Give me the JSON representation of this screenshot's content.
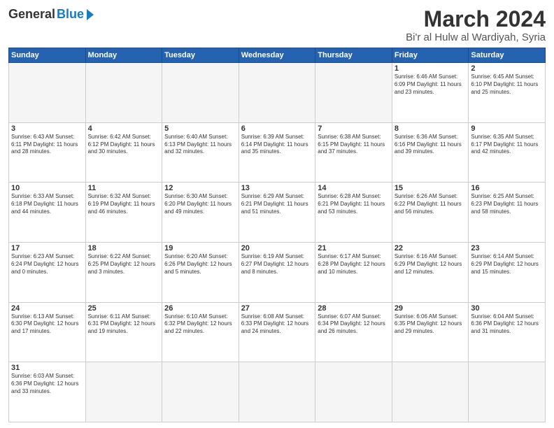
{
  "header": {
    "logo": {
      "general": "General",
      "blue": "Blue"
    },
    "title": "March 2024",
    "location": "Bi'r al Hulw al Wardiyah, Syria"
  },
  "weekdays": [
    "Sunday",
    "Monday",
    "Tuesday",
    "Wednesday",
    "Thursday",
    "Friday",
    "Saturday"
  ],
  "weeks": [
    [
      {
        "day": "",
        "info": ""
      },
      {
        "day": "",
        "info": ""
      },
      {
        "day": "",
        "info": ""
      },
      {
        "day": "",
        "info": ""
      },
      {
        "day": "",
        "info": ""
      },
      {
        "day": "1",
        "info": "Sunrise: 6:46 AM\nSunset: 6:09 PM\nDaylight: 11 hours\nand 23 minutes."
      },
      {
        "day": "2",
        "info": "Sunrise: 6:45 AM\nSunset: 6:10 PM\nDaylight: 11 hours\nand 25 minutes."
      }
    ],
    [
      {
        "day": "3",
        "info": "Sunrise: 6:43 AM\nSunset: 6:11 PM\nDaylight: 11 hours\nand 28 minutes."
      },
      {
        "day": "4",
        "info": "Sunrise: 6:42 AM\nSunset: 6:12 PM\nDaylight: 11 hours\nand 30 minutes."
      },
      {
        "day": "5",
        "info": "Sunrise: 6:40 AM\nSunset: 6:13 PM\nDaylight: 11 hours\nand 32 minutes."
      },
      {
        "day": "6",
        "info": "Sunrise: 6:39 AM\nSunset: 6:14 PM\nDaylight: 11 hours\nand 35 minutes."
      },
      {
        "day": "7",
        "info": "Sunrise: 6:38 AM\nSunset: 6:15 PM\nDaylight: 11 hours\nand 37 minutes."
      },
      {
        "day": "8",
        "info": "Sunrise: 6:36 AM\nSunset: 6:16 PM\nDaylight: 11 hours\nand 39 minutes."
      },
      {
        "day": "9",
        "info": "Sunrise: 6:35 AM\nSunset: 6:17 PM\nDaylight: 11 hours\nand 42 minutes."
      }
    ],
    [
      {
        "day": "10",
        "info": "Sunrise: 6:33 AM\nSunset: 6:18 PM\nDaylight: 11 hours\nand 44 minutes."
      },
      {
        "day": "11",
        "info": "Sunrise: 6:32 AM\nSunset: 6:19 PM\nDaylight: 11 hours\nand 46 minutes."
      },
      {
        "day": "12",
        "info": "Sunrise: 6:30 AM\nSunset: 6:20 PM\nDaylight: 11 hours\nand 49 minutes."
      },
      {
        "day": "13",
        "info": "Sunrise: 6:29 AM\nSunset: 6:21 PM\nDaylight: 11 hours\nand 51 minutes."
      },
      {
        "day": "14",
        "info": "Sunrise: 6:28 AM\nSunset: 6:21 PM\nDaylight: 11 hours\nand 53 minutes."
      },
      {
        "day": "15",
        "info": "Sunrise: 6:26 AM\nSunset: 6:22 PM\nDaylight: 11 hours\nand 56 minutes."
      },
      {
        "day": "16",
        "info": "Sunrise: 6:25 AM\nSunset: 6:23 PM\nDaylight: 11 hours\nand 58 minutes."
      }
    ],
    [
      {
        "day": "17",
        "info": "Sunrise: 6:23 AM\nSunset: 6:24 PM\nDaylight: 12 hours\nand 0 minutes."
      },
      {
        "day": "18",
        "info": "Sunrise: 6:22 AM\nSunset: 6:25 PM\nDaylight: 12 hours\nand 3 minutes."
      },
      {
        "day": "19",
        "info": "Sunrise: 6:20 AM\nSunset: 6:26 PM\nDaylight: 12 hours\nand 5 minutes."
      },
      {
        "day": "20",
        "info": "Sunrise: 6:19 AM\nSunset: 6:27 PM\nDaylight: 12 hours\nand 8 minutes."
      },
      {
        "day": "21",
        "info": "Sunrise: 6:17 AM\nSunset: 6:28 PM\nDaylight: 12 hours\nand 10 minutes."
      },
      {
        "day": "22",
        "info": "Sunrise: 6:16 AM\nSunset: 6:29 PM\nDaylight: 12 hours\nand 12 minutes."
      },
      {
        "day": "23",
        "info": "Sunrise: 6:14 AM\nSunset: 6:29 PM\nDaylight: 12 hours\nand 15 minutes."
      }
    ],
    [
      {
        "day": "24",
        "info": "Sunrise: 6:13 AM\nSunset: 6:30 PM\nDaylight: 12 hours\nand 17 minutes."
      },
      {
        "day": "25",
        "info": "Sunrise: 6:11 AM\nSunset: 6:31 PM\nDaylight: 12 hours\nand 19 minutes."
      },
      {
        "day": "26",
        "info": "Sunrise: 6:10 AM\nSunset: 6:32 PM\nDaylight: 12 hours\nand 22 minutes."
      },
      {
        "day": "27",
        "info": "Sunrise: 6:08 AM\nSunset: 6:33 PM\nDaylight: 12 hours\nand 24 minutes."
      },
      {
        "day": "28",
        "info": "Sunrise: 6:07 AM\nSunset: 6:34 PM\nDaylight: 12 hours\nand 26 minutes."
      },
      {
        "day": "29",
        "info": "Sunrise: 6:06 AM\nSunset: 6:35 PM\nDaylight: 12 hours\nand 29 minutes."
      },
      {
        "day": "30",
        "info": "Sunrise: 6:04 AM\nSunset: 6:36 PM\nDaylight: 12 hours\nand 31 minutes."
      }
    ],
    [
      {
        "day": "31",
        "info": "Sunrise: 6:03 AM\nSunset: 6:36 PM\nDaylight: 12 hours\nand 33 minutes."
      },
      {
        "day": "",
        "info": ""
      },
      {
        "day": "",
        "info": ""
      },
      {
        "day": "",
        "info": ""
      },
      {
        "day": "",
        "info": ""
      },
      {
        "day": "",
        "info": ""
      },
      {
        "day": "",
        "info": ""
      }
    ]
  ]
}
